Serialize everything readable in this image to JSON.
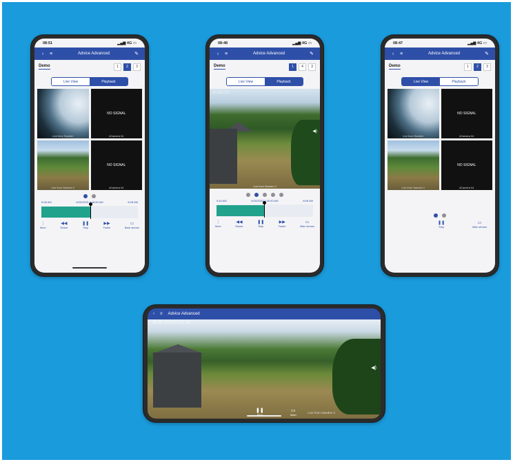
{
  "app": {
    "title": "Advice Advanced"
  },
  "colors": {
    "background": "#1a9bdc",
    "primary": "#2e4fa8",
    "timeline_fill": "#21a28c"
  },
  "phone1": {
    "time": "08:51",
    "signal": "4G",
    "demo": "Demo",
    "pages": [
      "1",
      "2",
      "3"
    ],
    "active_page": 2,
    "tabs": [
      "Live View",
      "Playback"
    ],
    "active_tab": "Playback",
    "tiles": [
      {
        "caption": "Live from Sweden"
      },
      {
        "caption": "#Camera 04",
        "status": "NO SIGNAL"
      },
      {
        "caption": "Live from Sweden 2"
      },
      {
        "caption": "#Camera 04",
        "status": "NO SIGNAL"
      }
    ],
    "timeline": {
      "start": "5:08 AM",
      "current": "6/20/2023 7:48:50 AM",
      "end": "8:08 AM",
      "progress": 0.51
    },
    "controls": [
      {
        "icon": "more-icon",
        "label": "More"
      },
      {
        "icon": "rewind-icon",
        "label": "Slower"
      },
      {
        "icon": "pause-icon",
        "label": "Stop"
      },
      {
        "icon": "fast-forward-icon",
        "label": "Faster"
      },
      {
        "icon": "fullscreen-icon",
        "label": "Back stream"
      }
    ]
  },
  "phone2": {
    "time": "08:48",
    "signal": "4G",
    "demo": "Demo",
    "pages": [
      "1",
      "4",
      "3"
    ],
    "active_page": 1,
    "tabs": [
      "Live View",
      "Playback"
    ],
    "active_tab": "Playback",
    "timestamp": "05:06/2023",
    "caption": "Live from Sweden 2",
    "timeline": {
      "start": "5:40 AM",
      "current": "6/20/2023 7:40:50 AM",
      "end": "8:08 AM",
      "progress": 0.49
    },
    "controls": [
      {
        "icon": "more-icon",
        "label": "More"
      },
      {
        "icon": "rewind-icon",
        "label": "Slower"
      },
      {
        "icon": "pause-icon",
        "label": "Stop"
      },
      {
        "icon": "fast-forward-icon",
        "label": "Faster"
      },
      {
        "icon": "fullscreen-icon",
        "label": "Main stream"
      }
    ]
  },
  "phone3": {
    "time": "08:47",
    "signal": "4G",
    "demo": "Demo",
    "pages": [
      "1",
      "2",
      "3"
    ],
    "active_page": 2,
    "tabs": [
      "Live View",
      "Playback"
    ],
    "active_tab": "Live View",
    "tiles": [
      {
        "caption": "Live from Sweden"
      },
      {
        "caption": "#Camera 04",
        "status": "NO SIGNAL"
      },
      {
        "caption": "Live from Sweden 2"
      },
      {
        "caption": "#Camera 04",
        "status": "NO SIGNAL"
      }
    ],
    "controls": [
      {
        "icon": "pause-icon",
        "label": "Stop"
      },
      {
        "icon": "fullscreen-icon",
        "label": "Main stream"
      }
    ]
  },
  "landscape": {
    "timestamp": "06-20-2023 07:47:46",
    "caption": "Live from Sweden 2",
    "controls": [
      {
        "icon": "pause-icon",
        "label": "Stop"
      },
      {
        "icon": "fullscreen-icon",
        "label": "Main"
      }
    ]
  }
}
